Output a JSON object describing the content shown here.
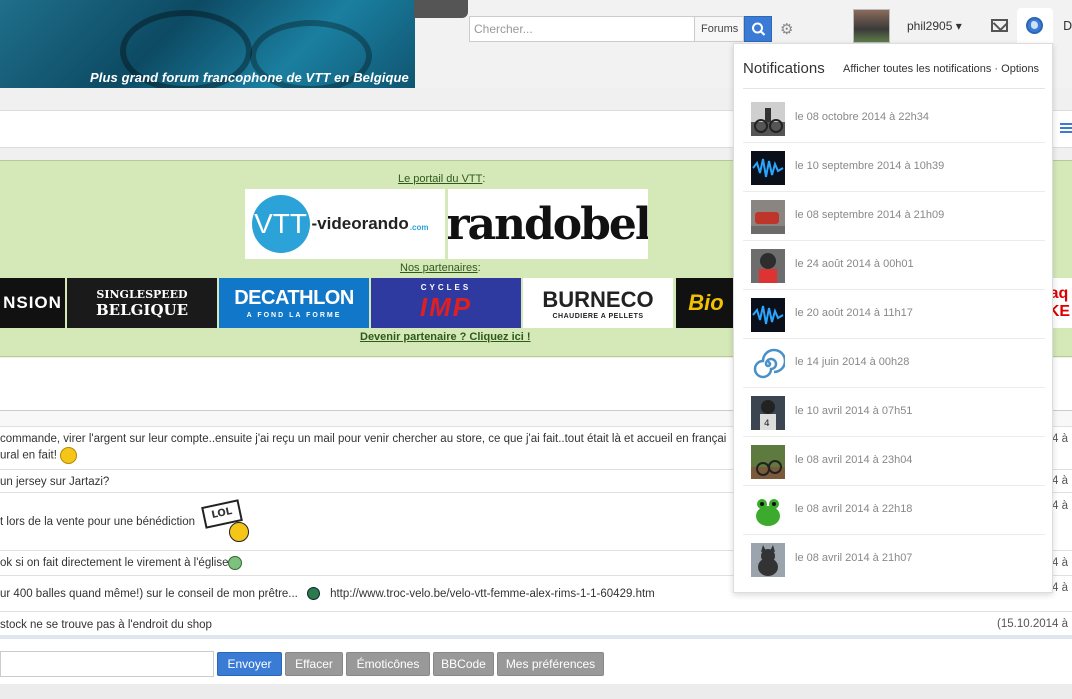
{
  "header": {
    "banner_text": "Plus grand forum francophone de VTT en Belgique",
    "search_placeholder": "Chercher...",
    "search_scope": "Forums",
    "username": "phil2905",
    "cut_label": "D"
  },
  "partners": {
    "portal_label": "Le portail du VTT",
    "portal_colon": " :",
    "videorando_circle": "VTT",
    "videorando_text": "-videorando",
    "videorando_com": ".com",
    "randobel": "randobel",
    "partners_label": "Nos partenaires",
    "partners_colon": " :",
    "become_partner": "Devenir partenaire ? Cliquez ici !",
    "logos": {
      "sion": "NSION",
      "ssb_1": "SINGLESPEED",
      "ssb_2": "BELGIQUE",
      "dec_1": "DECATHLON",
      "dec_2": "A FOND LA FORME",
      "imp_1": "CYCLES",
      "imp_2": "IMP",
      "bur_1": "BURNECO",
      "bur_2": "CHAUDIERE A PELLETS",
      "bio": "Bio",
      "right_1": "aq",
      "right_2": "KE"
    }
  },
  "shoutbox": {
    "rows": [
      {
        "text": "commande, virer l'argent sur leur compte..ensuite j'ai reçu un mail pour venir chercher au store, ce que j'ai fait..tout était là et accueil en françai",
        "text2": "ural en fait!",
        "date": "14 à"
      },
      {
        "text": "un jersey sur Jartazi?",
        "date": "14 à"
      },
      {
        "text": "t lors de la vente pour une bénédiction",
        "date": "14 à"
      },
      {
        "text": "ok si on fait directement le virement à l'église",
        "date": "14 à"
      },
      {
        "text": "ur 400 balles quand même!) sur le conseil de mon prêtre...",
        "link": "http://www.troc-velo.be/velo-vtt-femme-alex-rims-1-1-60429.htm",
        "date": "14 à"
      },
      {
        "text": "stock ne se trouve pas à l'endroit du shop",
        "date": "(15.10.2014 à"
      }
    ],
    "lol_sign": "LOL",
    "buttons": {
      "send": "Envoyer",
      "clear": "Effacer",
      "emoticons": "Émoticônes",
      "bbcode": "BBCode",
      "prefs": "Mes préférences"
    }
  },
  "notifications": {
    "title": "Notifications",
    "links": "Afficher toutes les notifications · Options",
    "items": [
      {
        "date": "le 08 octobre 2014 à 22h34",
        "thumb": "cyclist-photo"
      },
      {
        "date": "le 10 septembre 2014 à 10h39",
        "thumb": "blue-wave"
      },
      {
        "date": "le 08 septembre 2014 à 21h09",
        "thumb": "red-car"
      },
      {
        "date": "le 24 août 2014 à 00h01",
        "thumb": "rider-helmet"
      },
      {
        "date": "le 20 août 2014 à 11h17",
        "thumb": "blue-wave"
      },
      {
        "date": "le 14 juin 2014 à 00h28",
        "thumb": "spiral"
      },
      {
        "date": "le 10 avril 2014 à 07h51",
        "thumb": "rider-dark"
      },
      {
        "date": "le 08 avril 2014 à 23h04",
        "thumb": "bike-trail"
      },
      {
        "date": "le 08 avril 2014 à 22h18",
        "thumb": "green-frog"
      },
      {
        "date": "le 08 avril 2014 à 21h07",
        "thumb": "grey-cat"
      }
    ]
  },
  "colors": {
    "accent": "#3a7bd5",
    "partner_bg": "#d5e8b8"
  }
}
